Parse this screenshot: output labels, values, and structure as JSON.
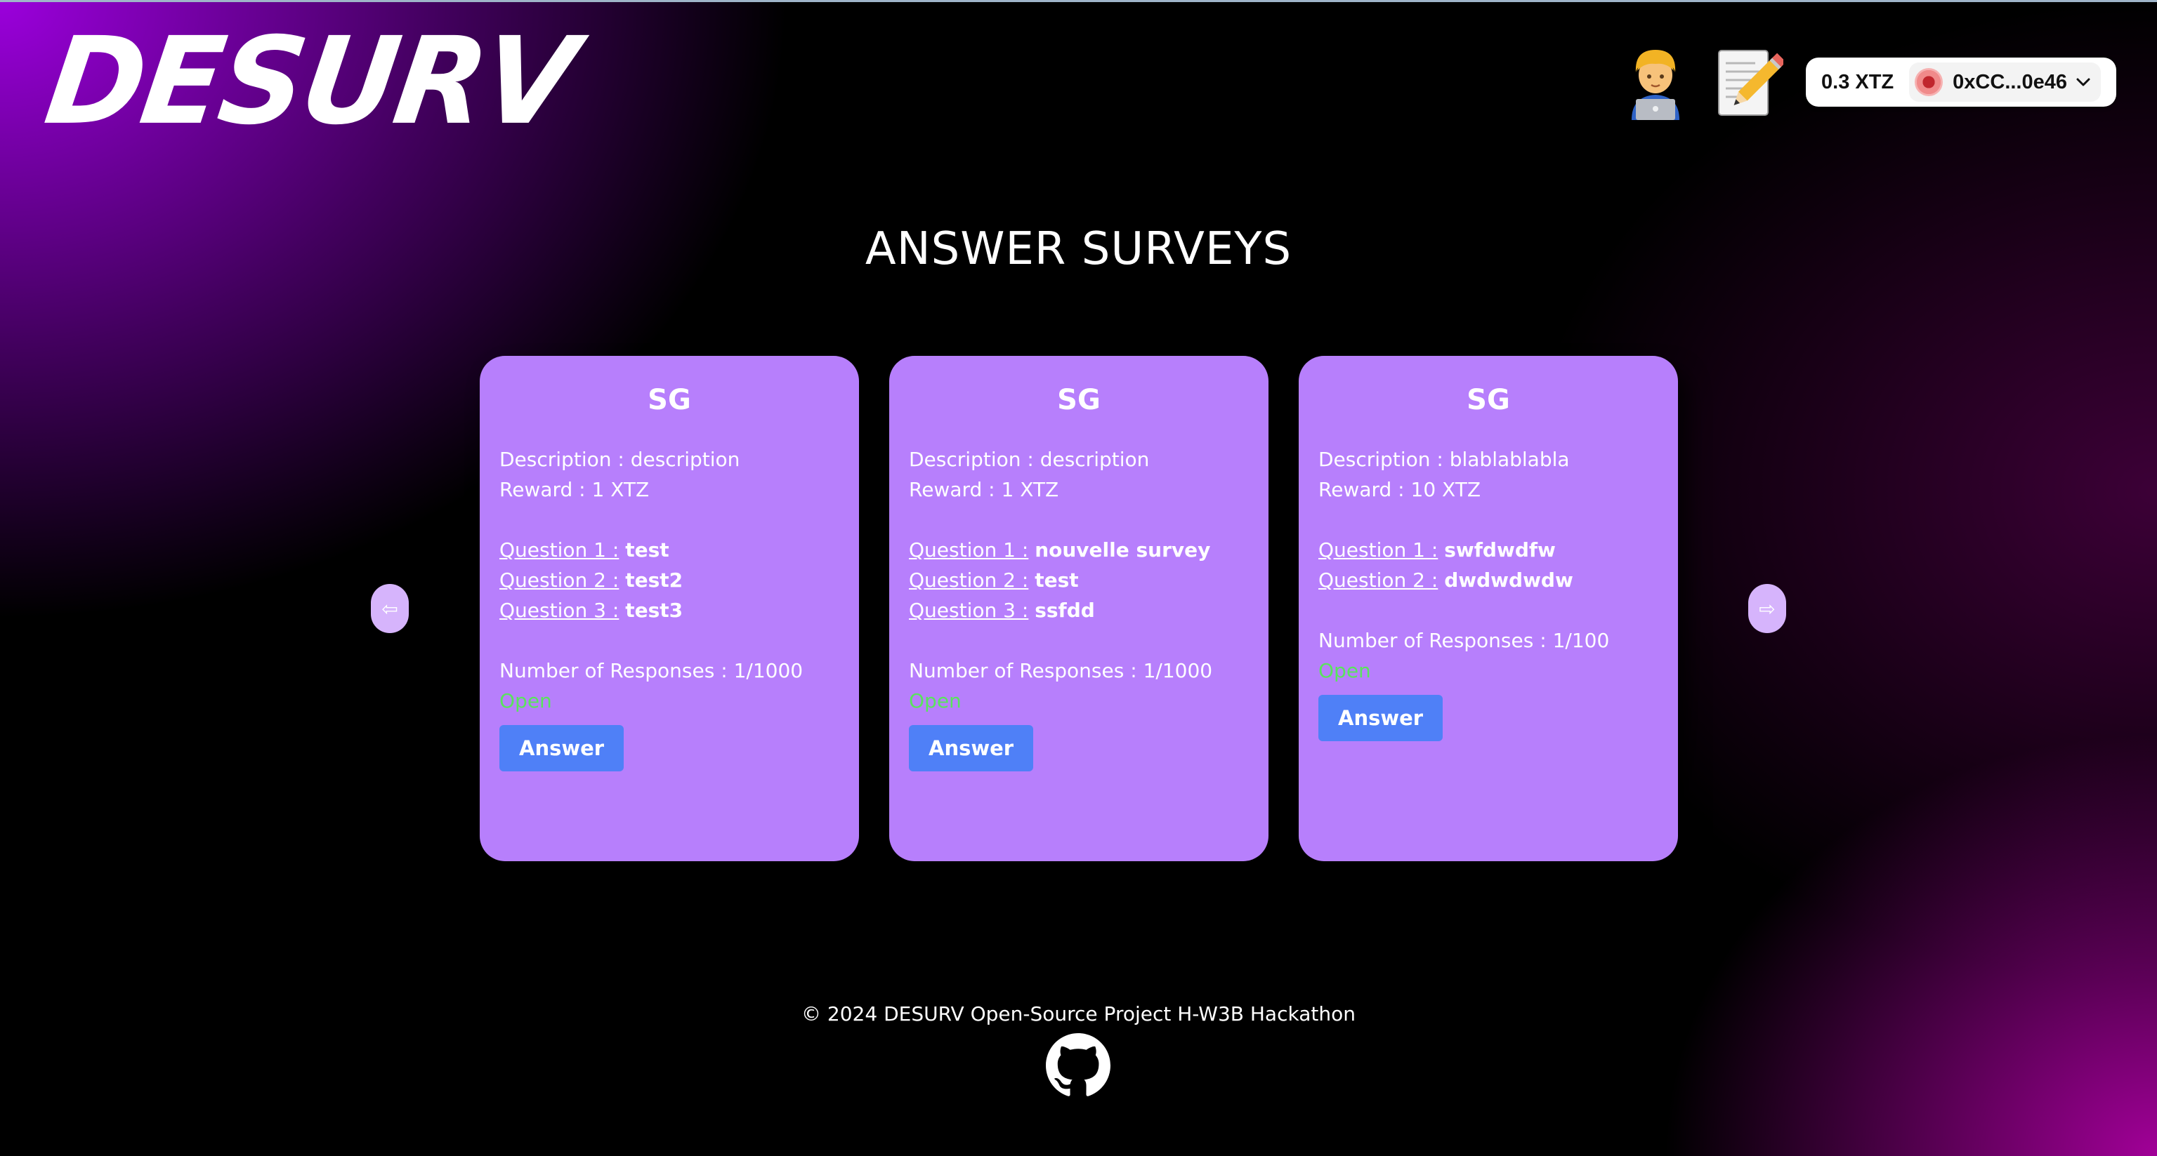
{
  "header": {
    "logo_text": "DESURV",
    "profile_icon": "technologist-emoji-icon",
    "create_icon": "memo-pencil-emoji-icon",
    "wallet": {
      "balance": "0.3 XTZ",
      "address": "0xCC...0e46"
    }
  },
  "page": {
    "title": "ANSWER SURVEYS"
  },
  "carousel": {
    "prev_label": "⇦",
    "next_label": "⇨"
  },
  "surveys": [
    {
      "title": "SG",
      "description_label": "Description : ",
      "description": "description",
      "reward_label": "Reward : ",
      "reward": "1 XTZ",
      "questions": [
        {
          "label": "Question 1 :",
          "text": "test"
        },
        {
          "label": "Question 2 :",
          "text": "test2"
        },
        {
          "label": "Question 3 :",
          "text": "test3"
        }
      ],
      "responses_label": "Number of Responses : ",
      "responses": "1/1000",
      "status": "Open",
      "button_label": "Answer"
    },
    {
      "title": "SG",
      "description_label": "Description : ",
      "description": "description",
      "reward_label": "Reward : ",
      "reward": "1 XTZ",
      "questions": [
        {
          "label": "Question 1 :",
          "text": "nouvelle survey"
        },
        {
          "label": "Question 2 :",
          "text": "test"
        },
        {
          "label": "Question 3 :",
          "text": "ssfdd"
        }
      ],
      "responses_label": "Number of Responses : ",
      "responses": "1/1000",
      "status": "Open",
      "button_label": "Answer"
    },
    {
      "title": "SG",
      "description_label": "Description : ",
      "description": "blablablabla",
      "reward_label": "Reward : ",
      "reward": "10 XTZ",
      "questions": [
        {
          "label": "Question 1 :",
          "text": "swfdwdfw"
        },
        {
          "label": "Question 2 :",
          "text": "dwdwdwdw"
        }
      ],
      "responses_label": "Number of Responses : ",
      "responses": "1/100",
      "status": "Open",
      "button_label": "Answer"
    }
  ],
  "footer": {
    "text": "© 2024 DESURV Open-Source Project H-W3B Hackathon",
    "github_icon": "github-icon"
  },
  "colors": {
    "card_bg": "#b77ffc",
    "button_bg": "#4f80f7",
    "status_open": "#59e45c",
    "arrow_bg": "#d6b4fc",
    "brand_purple": "#9b00dc"
  }
}
